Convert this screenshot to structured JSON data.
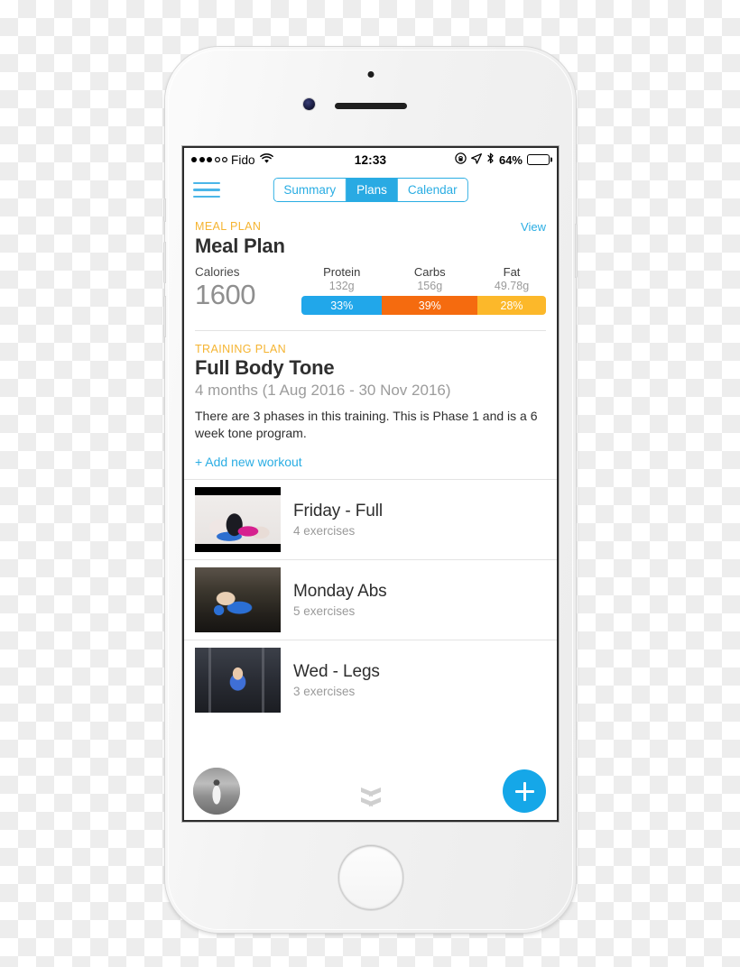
{
  "status_bar": {
    "signal_dots_filled": 3,
    "signal_dots_total": 5,
    "carrier": "Fido",
    "wifi_icon": "wifi-icon",
    "time": "12:33",
    "rotation_lock_icon": "rotation-lock-icon",
    "location_icon": "location-arrow-icon",
    "bluetooth_icon": "bluetooth-icon",
    "battery_percent": "64%",
    "battery_level": 64
  },
  "nav": {
    "menu_icon": "hamburger-menu-icon",
    "tabs": [
      {
        "label": "Summary",
        "active": false
      },
      {
        "label": "Plans",
        "active": true
      },
      {
        "label": "Calendar",
        "active": false
      }
    ]
  },
  "meal_plan": {
    "eyebrow": "MEAL PLAN",
    "title": "Meal Plan",
    "view_label": "View",
    "calories_label": "Calories",
    "calories_value": "1600",
    "macros": [
      {
        "name": "Protein",
        "grams": "132g",
        "percent": "33%",
        "pct_value": 33,
        "color": "#21a7ea"
      },
      {
        "name": "Carbs",
        "grams": "156g",
        "percent": "39%",
        "pct_value": 39,
        "color": "#f56b0f"
      },
      {
        "name": "Fat",
        "grams": "49.78g",
        "percent": "28%",
        "pct_value": 28,
        "color": "#fcb82a"
      }
    ]
  },
  "training_plan": {
    "eyebrow": "TRAINING PLAN",
    "title": "Full Body Tone",
    "dates": "4 months (1 Aug 2016 - 30 Nov 2016)",
    "description": "There are 3 phases in this training. This is Phase 1 and is a 6 week tone program.",
    "add_workout_label": "+ Add new workout",
    "workouts": [
      {
        "title": "Friday - Full",
        "subtitle": "4 exercises",
        "thumb": "workout-thumbnail-friday"
      },
      {
        "title": "Monday Abs",
        "subtitle": "5 exercises",
        "thumb": "workout-thumbnail-monday"
      },
      {
        "title": "Wed - Legs",
        "subtitle": "3 exercises",
        "thumb": "workout-thumbnail-wed"
      }
    ]
  },
  "bottom_bar": {
    "avatar_name": "user-avatar",
    "collapse_icon": "double-chevron-down-icon",
    "fab_icon": "plus-icon"
  },
  "theme": {
    "accent_blue": "#29aae3",
    "accent_amber": "#f5b431",
    "fab_blue": "#15a7e8",
    "text_dark": "#2f2f2f",
    "text_muted": "#9a9a9a"
  }
}
